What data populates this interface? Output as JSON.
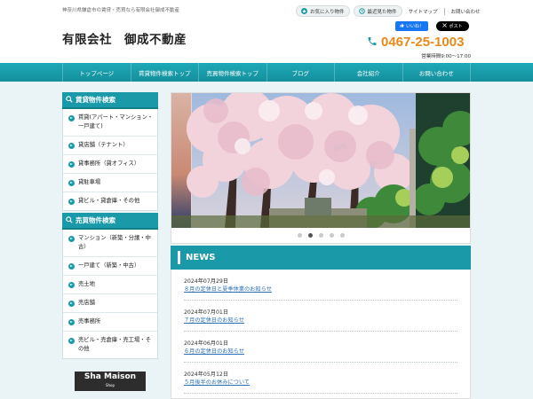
{
  "header": {
    "tagline": "神奈川県鎌倉市の賃貸・売買なら有限会社御成不動産",
    "company_name": "有限会社　御成不動産",
    "favorites_label": "お気に入り物件",
    "recent_label": "最近見た物件",
    "sitemap_label": "サイトマップ",
    "contact_label": "お問い合わせ",
    "fb_label": "いいね！",
    "x_label": "ポスト",
    "phone": "0467-25-1003",
    "hours": "営業時間9:00～17:00"
  },
  "nav": {
    "items": [
      {
        "label": "トップページ"
      },
      {
        "label": "賃貸物件検索トップ"
      },
      {
        "label": "売買物件検索トップ"
      },
      {
        "label": "ブログ"
      },
      {
        "label": "会社紹介"
      },
      {
        "label": "お問い合わせ"
      }
    ]
  },
  "sidebar": {
    "rental": {
      "title": "賃貸物件検索",
      "items": [
        {
          "label": "賃貸(アパート・マンション・一戸建て)"
        },
        {
          "label": "貸店舗（テナント）"
        },
        {
          "label": "貸事務所（貸オフィス）"
        },
        {
          "label": "貸駐車場"
        },
        {
          "label": "貸ビル・貸倉庫・その他"
        }
      ]
    },
    "sale": {
      "title": "売買物件検索",
      "items": [
        {
          "label": "マンション（新築・分譲・中古）"
        },
        {
          "label": "一戸建て（新築・中古）"
        },
        {
          "label": "売土地"
        },
        {
          "label": "売店舗"
        },
        {
          "label": "売事務所"
        },
        {
          "label": "売ビル・売倉庫・売工場・その他"
        }
      ]
    },
    "banner": {
      "title": "Sha Maison",
      "subtitle": "Shop"
    }
  },
  "slider": {
    "dot_count": 5,
    "active_index": 1
  },
  "news": {
    "title": "NEWS",
    "items": [
      {
        "date": "2024年07月29日",
        "text": "８月の定休日と夏季休業のお知らせ"
      },
      {
        "date": "2024年07月01日",
        "text": "７月の定休日のお知らせ"
      },
      {
        "date": "2024年06月01日",
        "text": "６月の定休日のお知らせ"
      },
      {
        "date": "2024年05月12日",
        "text": "５月後半のお休みについて"
      }
    ]
  },
  "colors": {
    "accent": "#1a9aa8",
    "phone": "#e8891a",
    "link": "#2a6fb5"
  }
}
